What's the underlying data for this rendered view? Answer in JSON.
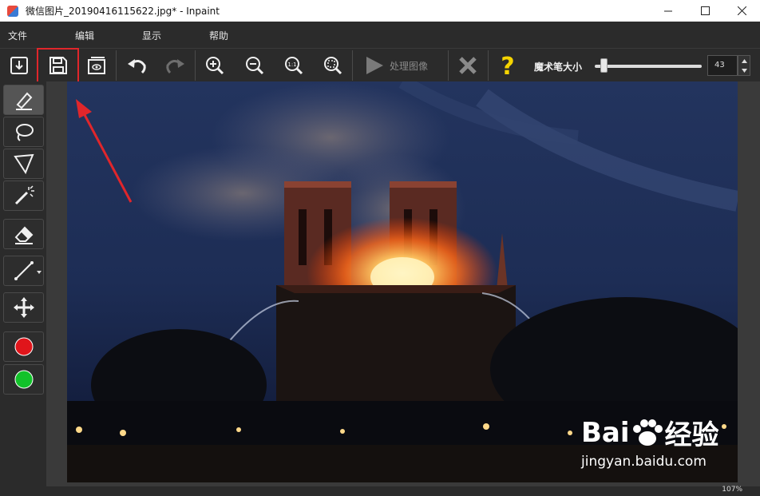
{
  "window": {
    "title": "微信图片_20190416115622.jpg* - Inpaint",
    "controls": [
      "minimize",
      "maximize",
      "close"
    ]
  },
  "menu": {
    "items": [
      {
        "label": "文件"
      },
      {
        "label": "编辑"
      },
      {
        "label": "显示"
      },
      {
        "label": "帮助"
      }
    ]
  },
  "toolbar": {
    "process_label": "处理图像",
    "magic_wand_label": "魔术笔大小",
    "brush_size": "43",
    "icons": [
      "open-icon",
      "save-icon",
      "preview-icon",
      "undo-icon",
      "redo-icon",
      "zoom-in-icon",
      "zoom-out-icon",
      "zoom-actual-icon",
      "zoom-fit-icon",
      "play-icon",
      "cancel-icon",
      "help-icon"
    ]
  },
  "tools": {
    "icons": [
      "marker-icon",
      "lasso-icon",
      "polygon-lasso-icon",
      "magic-wand-icon",
      "eraser-icon",
      "line-icon",
      "move-icon",
      "red-color-icon",
      "green-color-icon"
    ],
    "colors": {
      "red": "#e0151b",
      "green": "#12c22a"
    }
  },
  "status": {
    "zoom": "107%"
  },
  "watermark": {
    "brand": "Bai",
    "brand_cn": "经验",
    "url": "jingyan.baidu.com"
  },
  "colors": {
    "highlight": "#e0262b",
    "accent_help": "#f5d400"
  }
}
